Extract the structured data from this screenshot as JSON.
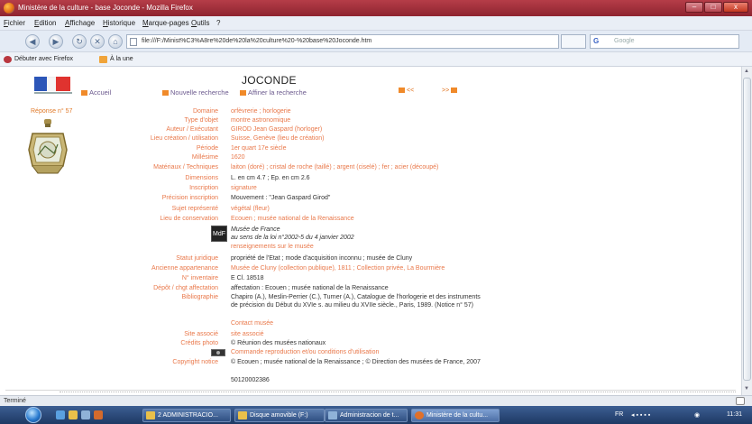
{
  "window": {
    "title": "Ministère de la culture - base Joconde - Mozilla Firefox",
    "buttons": [
      "–",
      "□",
      "x"
    ]
  },
  "menu": [
    "Fichier",
    "Edition",
    "Affichage",
    "Historique",
    "Marque-pages",
    "Outils",
    "?"
  ],
  "nav": {
    "url": "file:///F:/Minist%C3%A8re%20de%20la%20culture%20-%20base%20Joconde.htm",
    "search_placeholder": "Google",
    "search_engine": "G"
  },
  "bookmarks": [
    "Débuter avec Firefox",
    "À la une"
  ],
  "page": {
    "title": "JOCONDE",
    "links": {
      "home": "Accueil",
      "new_search": "Nouvelle recherche",
      "refine": "Affiner la recherche",
      "prev": "<<",
      "next": ">>"
    },
    "response": "Réponse n° 57",
    "fields": [
      {
        "label": "Domaine",
        "value": "orfèvrerie ; horlogerie"
      },
      {
        "label": "Type d'objet",
        "value": "montre astronomique"
      },
      {
        "label": "Auteur / Exécutant",
        "value": "GIROD Jean Gaspard (horloger)"
      },
      {
        "label": "Lieu création / utilisation",
        "value": "Suisse, Genève (lieu de création)"
      },
      {
        "label": "Période",
        "value": "1er quart 17e siècle"
      },
      {
        "label": "Millésime",
        "value": "1620"
      },
      {
        "label": "Matériaux / Techniques",
        "value": "laiton (doré) ; cristal de roche (taillé) ; argent (ciselé) ; fer ; acier (découpé)"
      },
      {
        "label": "Dimensions",
        "value": "L. en cm 4.7 ; Ep. en cm 2.6"
      },
      {
        "label": "Inscription",
        "value": "signature"
      },
      {
        "label": "Précision inscription",
        "value": "Mouvement : \"Jean Gaspard Girod\""
      },
      {
        "label": "Sujet représenté",
        "value": "végétal (fleur)"
      },
      {
        "label": "Lieu de conservation",
        "value": "Ecouen ; musée national de la Renaissance"
      }
    ],
    "mdf": {
      "icon": "MdF",
      "line1": "Musée de France",
      "line2": "au sens de la loi n°2002-5 du 4 janvier 2002",
      "link": "renseignements sur le musée"
    },
    "fields2": [
      {
        "label": "Statut juridique",
        "value": "propriété de l'Etat ; mode d'acquisition inconnu ; musée de Cluny"
      },
      {
        "label": "Ancienne appartenance",
        "value": "Musée de Cluny (collection publique), 1811 ; Collection privée, La Bourmière"
      },
      {
        "label": "N° inventaire",
        "value": "E Cl. 18518"
      },
      {
        "label": "Dépôt / chgt affectation",
        "value": "affectation : Ecouen ; musée national de la Renaissance"
      }
    ],
    "bibliography": {
      "label": "Bibliographie",
      "value": "Chapiro (A.), Meslin-Perrier (C.), Turner (A.), Catalogue de l'horlogerie et des instruments de précision du Début du XVIe s. au milieu du XVIIe siècle., Paris, 1989. (Notice n° 57)"
    },
    "contact": "Contact musée",
    "site": {
      "label": "Site associé",
      "value": "site associé"
    },
    "photo_credit": {
      "label": "Crédits photo",
      "value": "© Réunion des musées nationaux"
    },
    "order_link": "Commande reproduction et/ou conditions d'utilisation",
    "copyright": {
      "label": "Copyright notice",
      "value": "© Ecouen ; musée national de la Renaissance ; © Direction des musées de France, 2007"
    },
    "reference": "50120002386"
  },
  "status": "Terminé",
  "taskbar": {
    "tasks": [
      "2 ADMINISTRACIO...",
      "Disque amovible (F:)",
      "Administracion de t...",
      "Ministère de la cultu..."
    ],
    "lang": "FR",
    "time": "11:31"
  },
  "colors": {
    "label": "#e9784a",
    "accent": "#f08a2a",
    "titlebar": "#a83140"
  }
}
